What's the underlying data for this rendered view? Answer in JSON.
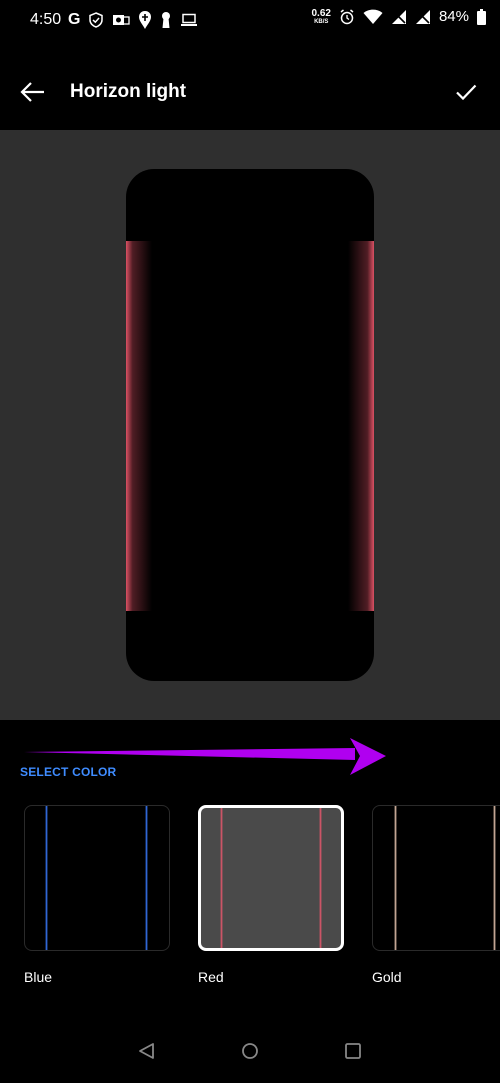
{
  "status_bar": {
    "time": "4:50",
    "net_speed_value": "0.62",
    "net_speed_unit": "KB/S",
    "battery_percent": "84%"
  },
  "app_bar": {
    "title": "Horizon light"
  },
  "select_color": {
    "label": "SELECT COLOR",
    "options": [
      {
        "name": "Blue",
        "color": "#3a7bff",
        "selected": false
      },
      {
        "name": "Red",
        "color": "#e5566b",
        "selected": true
      },
      {
        "name": "Gold",
        "color": "#e8c5b0",
        "selected": false
      }
    ]
  },
  "annotation": {
    "arrow_color": "#b000f0"
  }
}
